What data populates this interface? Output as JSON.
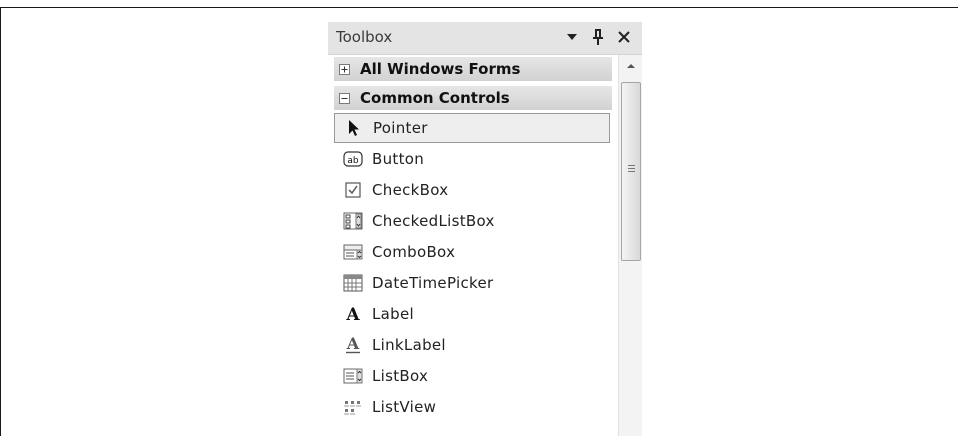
{
  "toolbox": {
    "title": "Toolbox",
    "icons": [
      "dropdown-icon",
      "pin-icon",
      "close-icon"
    ]
  },
  "categories": [
    {
      "label": "All Windows Forms",
      "expanded": false
    },
    {
      "label": "Common Controls",
      "expanded": true
    }
  ],
  "items": [
    {
      "label": "Pointer",
      "icon": "pointer-icon",
      "selected": true
    },
    {
      "label": "Button",
      "icon": "button-icon"
    },
    {
      "label": "CheckBox",
      "icon": "checkbox-icon"
    },
    {
      "label": "CheckedListBox",
      "icon": "checkedlistbox-icon"
    },
    {
      "label": "ComboBox",
      "icon": "combobox-icon"
    },
    {
      "label": "DateTimePicker",
      "icon": "datetimepicker-icon"
    },
    {
      "label": "Label",
      "icon": "label-icon"
    },
    {
      "label": "LinkLabel",
      "icon": "linklabel-icon"
    },
    {
      "label": "ListBox",
      "icon": "listbox-icon"
    },
    {
      "label": "ListView",
      "icon": "listview-icon"
    }
  ]
}
